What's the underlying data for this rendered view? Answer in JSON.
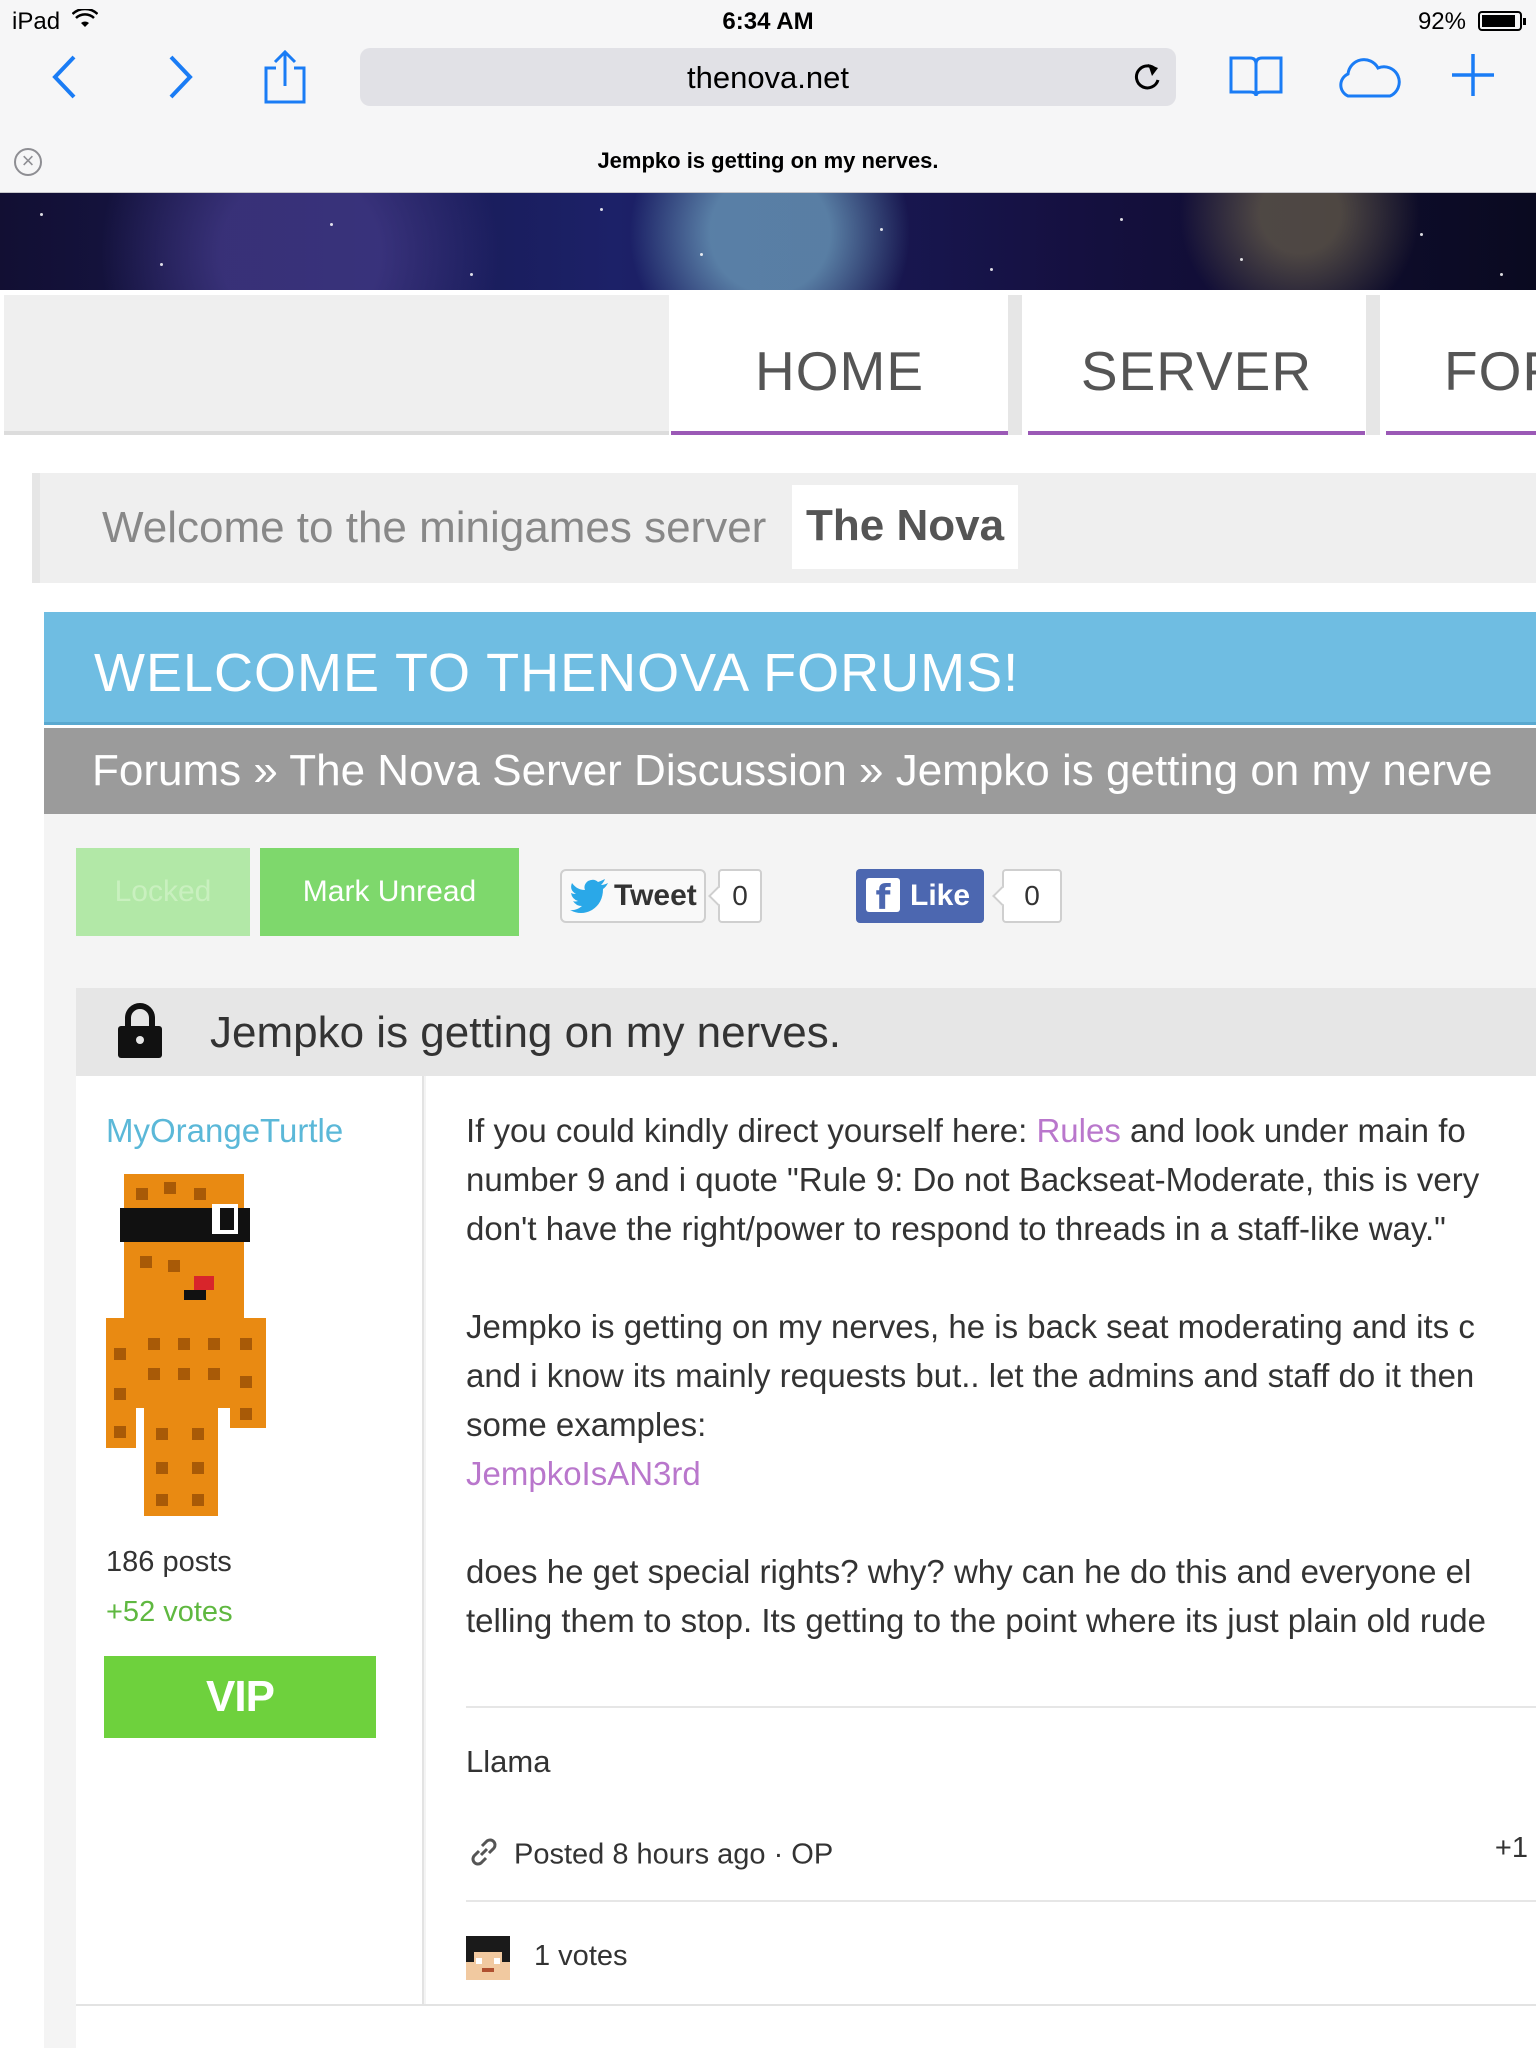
{
  "status_bar": {
    "carrier": "iPad",
    "time": "6:34 AM",
    "battery": "92%",
    "battery_level": 0.92
  },
  "browser": {
    "url": "thenova.net",
    "tab_title": "Jempko is getting on my nerves.",
    "icons": [
      "back-icon",
      "forward-icon",
      "share-icon",
      "reload-icon",
      "bookmarks-icon",
      "icloud-tabs-icon",
      "new-tab-icon",
      "close-tab-icon"
    ]
  },
  "nav": {
    "home": "HOME",
    "server": "SERVER",
    "forums": "FOR"
  },
  "welcome": {
    "text": "Welcome to the minigames server",
    "brand": "The Nova"
  },
  "forum": {
    "heading": "WELCOME TO THENOVA FORUMS!",
    "breadcrumb": "Forums » The Nova Server Discussion » Jempko is getting on my nerve"
  },
  "actions": {
    "locked": "Locked",
    "mark_unread": "Mark Unread",
    "tweet": "Tweet",
    "tweet_count": "0",
    "like": "Like",
    "like_count": "0"
  },
  "thread": {
    "title": "Jempko is getting on my nerves."
  },
  "post": {
    "author": "MyOrangeTurtle",
    "posts": "186 posts",
    "votes": "+52 votes",
    "rank": "VIP",
    "line1_pre": "If you could kindly direct yourself here: ",
    "line1_link": "Rules",
    "line1_post": " and look under main fo",
    "line2": "number 9 and i quote \"Rule 9: Do not Backseat-Moderate, this is very",
    "line3": "don't have the right/power to respond to threads in a staff-like way.\"",
    "line4": "Jempko is getting on my nerves, he is back seat moderating and its c",
    "line5": "and i know its mainly requests but.. let the admins and staff do it then",
    "line6": "some examples:",
    "line7_link": "JempkoIsAN3rd",
    "line8": "does he get special rights? why? why can he do this and everyone el",
    "line9": "telling them to stop. Its getting to the point where its just plain old rude",
    "signature": "Llama",
    "posted": "Posted 8 hours ago · OP",
    "plus_one": "+1",
    "vote_count": "1 votes"
  },
  "colors": {
    "accent_purple": "#9b59b6",
    "forum_blue": "#6fbde2",
    "green_button": "#7ed86c",
    "vip_green": "#6ed13d",
    "link_purple": "#b977cc",
    "ios_blue": "#1a7cf5"
  }
}
